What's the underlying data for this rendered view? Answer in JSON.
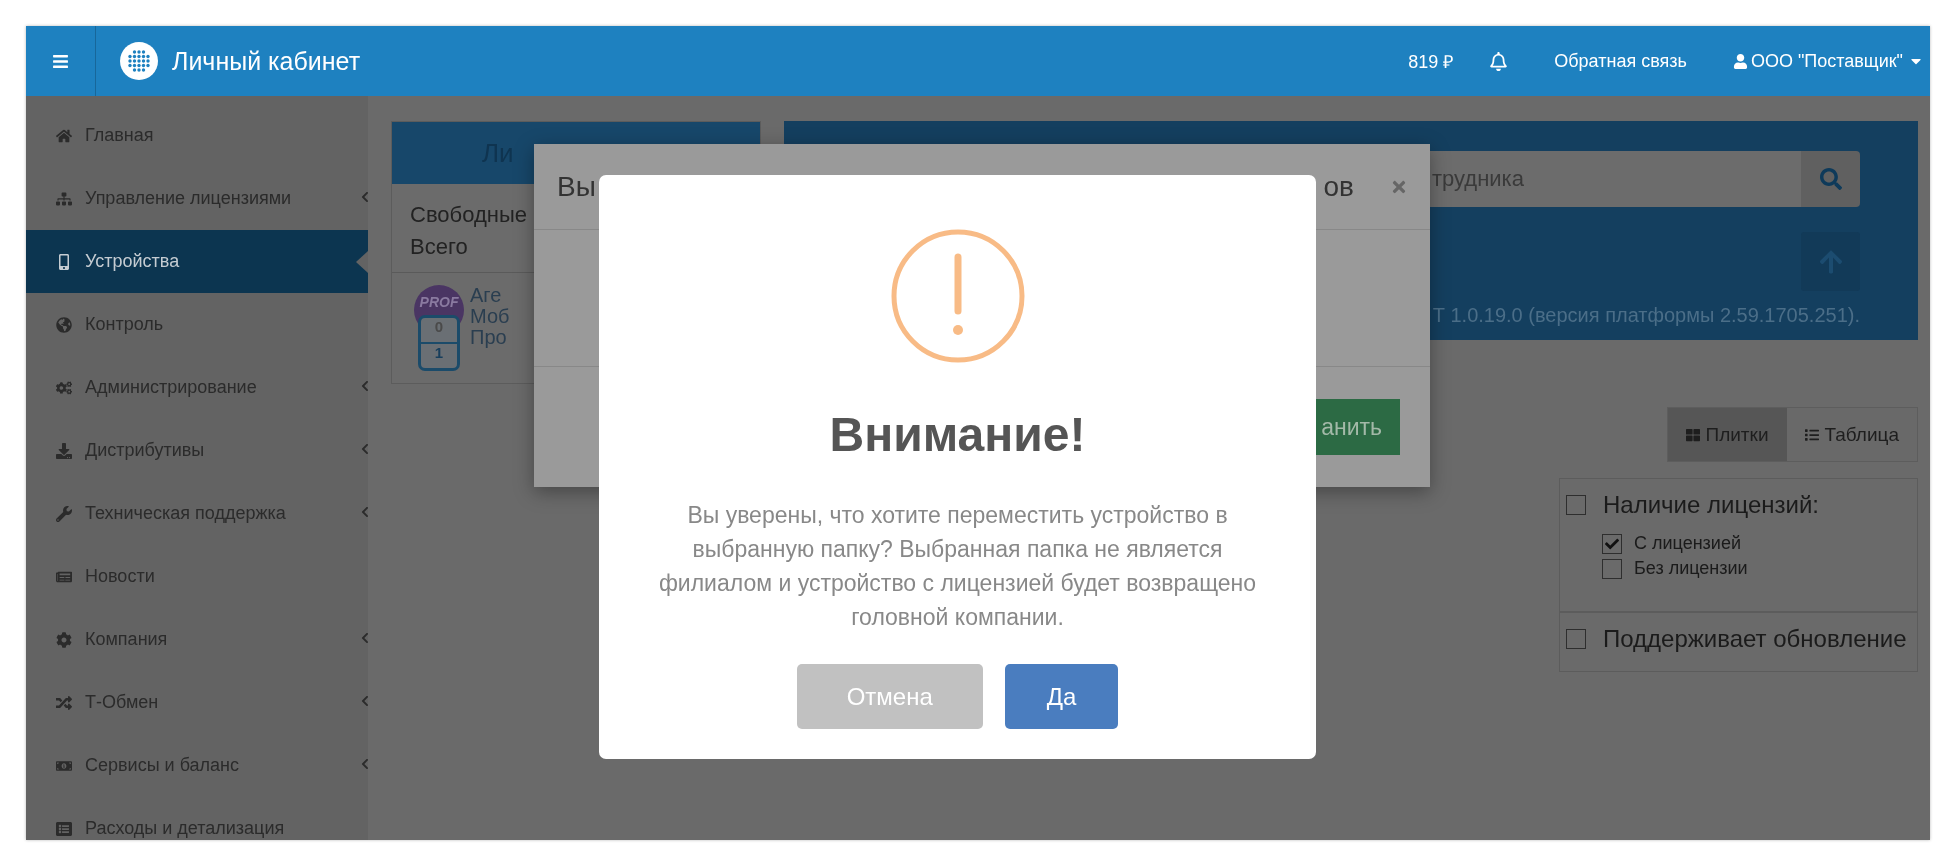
{
  "topbar": {
    "title": "Личный кабинет",
    "balance": "819 ₽",
    "feedback": "Обратная связь",
    "account": "ООО \"Поставщик\""
  },
  "sidebar": {
    "items": [
      {
        "label": "Главная",
        "expandable": false,
        "selected": false
      },
      {
        "label": "Управление лицензиями",
        "expandable": true,
        "selected": false
      },
      {
        "label": "Устройства",
        "expandable": false,
        "selected": true
      },
      {
        "label": "Контроль",
        "expandable": false,
        "selected": false
      },
      {
        "label": "Администрирование",
        "expandable": true,
        "selected": false
      },
      {
        "label": "Дистрибутивы",
        "expandable": true,
        "selected": false
      },
      {
        "label": "Техническая поддержка",
        "expandable": true,
        "selected": false
      },
      {
        "label": "Новости",
        "expandable": false,
        "selected": false
      },
      {
        "label": "Компания",
        "expandable": true,
        "selected": false
      },
      {
        "label": "Т-Обмен",
        "expandable": true,
        "selected": false
      },
      {
        "label": "Сервисы и баланс",
        "expandable": true,
        "selected": false
      },
      {
        "label": "Расходы и детализация",
        "expandable": false,
        "selected": false
      }
    ]
  },
  "licenses_card": {
    "header": "Ли",
    "rows": [
      "Свободные",
      "Всего"
    ],
    "device": {
      "badge": "PROF",
      "counts": [
        "0",
        "1"
      ],
      "lines": [
        "Аге",
        "Моб",
        "Про"
      ]
    }
  },
  "search_panel": {
    "placeholder": "трудника",
    "version": "Т 1.0.19.0 (версия платформы 2.59.1705.251)."
  },
  "view_toggle": [
    {
      "label": "Плитки",
      "selected": true
    },
    {
      "label": "Таблица",
      "selected": false
    }
  ],
  "filters": [
    {
      "label": "Наличие лицензий:",
      "checked": false,
      "options": [
        {
          "label": "С лицензией",
          "checked": true
        },
        {
          "label": "Без лицензии",
          "checked": false
        }
      ]
    },
    {
      "label": "Поддерживает обновление",
      "checked": false
    }
  ],
  "folder_dialog": {
    "title_start": "Вы",
    "title_end": "ов",
    "save_button": "анить"
  },
  "alert": {
    "title": "Внимание!",
    "message": "Вы уверены, что хотите переместить устройство в выбранную папку? Выбранная папка не является филиалом и устройство с лицензией будет возвращено головной компании.",
    "buttons": [
      {
        "label": "Отмена",
        "kind": "cancel"
      },
      {
        "label": "Да",
        "kind": "confirm"
      }
    ]
  }
}
